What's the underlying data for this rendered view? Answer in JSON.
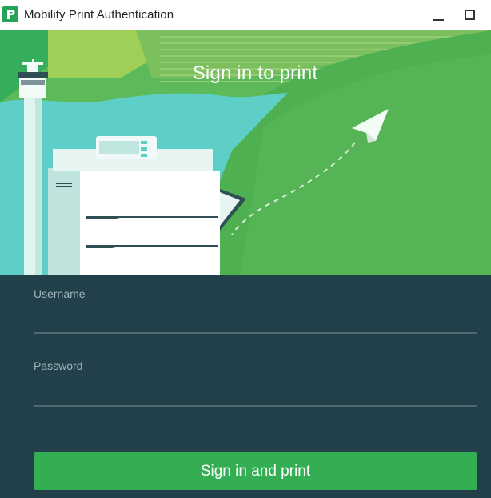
{
  "window": {
    "title": "Mobility Print Authentication",
    "app_icon": "papercut-logo-icon",
    "controls": [
      "minimize-icon",
      "maximize-icon"
    ]
  },
  "hero": {
    "heading": "Sign in to print",
    "illustration": [
      "control-tower",
      "printer",
      "paper-airplane",
      "green-hills"
    ]
  },
  "form": {
    "username_label": "Username",
    "username_value": "",
    "password_label": "Password",
    "password_value": "",
    "submit_label": "Sign in and print"
  },
  "colors": {
    "accent": "#34ae52",
    "form_background": "#22404a",
    "hero_green": "#5cba5a",
    "hero_teal": "#5ecfc7"
  }
}
